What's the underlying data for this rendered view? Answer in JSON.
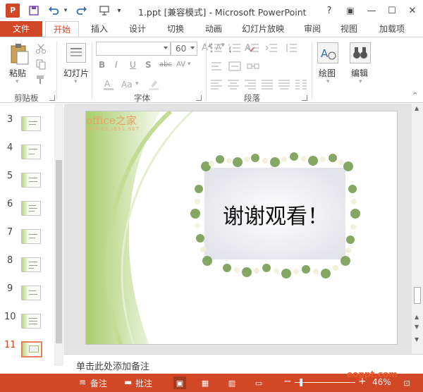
{
  "app": {
    "logo": "P",
    "title": "1.ppt [兼容模式] - Microsoft PowerPoint",
    "qa_items": [
      "save-icon",
      "undo-icon",
      "redo-icon",
      "slideshow-icon"
    ],
    "qa_customize": "▾",
    "window_buttons": [
      "?",
      "▣",
      "—",
      "☐",
      "✕"
    ]
  },
  "tabs": [
    "文件",
    "开始",
    "插入",
    "设计",
    "切换",
    "动画",
    "幻灯片放映",
    "审阅",
    "视图",
    "加载项"
  ],
  "ribbon": {
    "groups": {
      "clipboard": "剪贴板",
      "slides": "",
      "font": "字体",
      "paragraph": "段落"
    },
    "paste_label": "粘贴",
    "slide_label": "幻灯片",
    "font_name": "",
    "font_size": "60",
    "format_buttons": [
      "B",
      "I",
      "U",
      "S",
      "abc",
      "AV"
    ],
    "aa_label": "Aa",
    "drawing_label": "绘图",
    "edit_label": "编辑",
    "colors": {
      "accent": "#d24726",
      "ribbon_border": "#d4d4d4"
    }
  },
  "thumbnails": {
    "numbers": [
      "3",
      "4",
      "5",
      "6",
      "7",
      "8",
      "9",
      "10",
      "11"
    ],
    "selected": "11"
  },
  "slide": {
    "watermark": "office之家",
    "watermark_url": "OFFICE.JB51.NET",
    "text": "谢谢观看！"
  },
  "notes_placeholder": "单击此处添加备注",
  "statusbar": {
    "notes": "备注",
    "comments": "批注",
    "zoom_out": "−",
    "zoom_in": "+",
    "zoom": "46%",
    "site_mark": "eoppt.com"
  }
}
